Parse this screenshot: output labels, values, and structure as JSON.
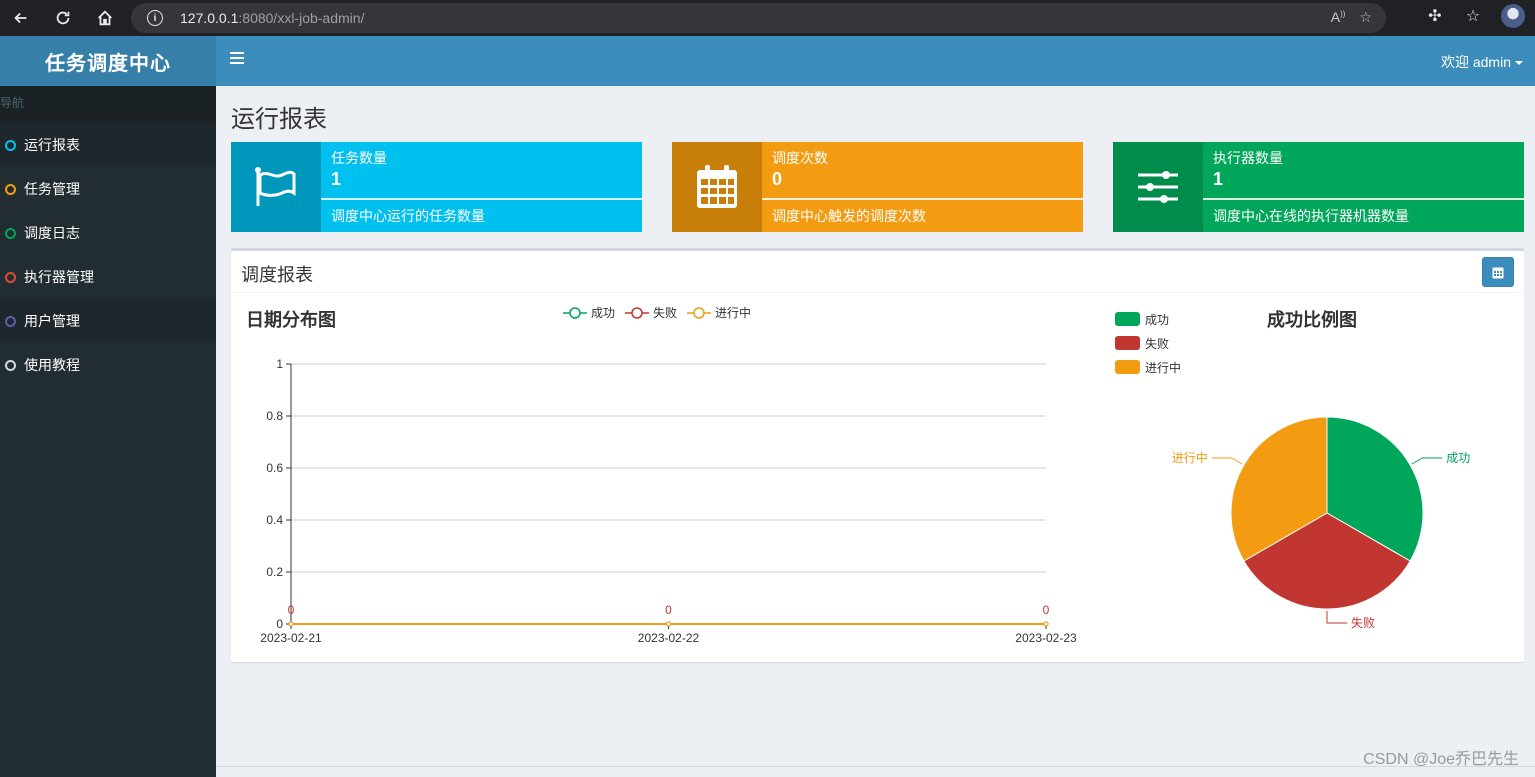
{
  "browser": {
    "url_host": "127.0.0.1",
    "url_rest": ":8080/xxl-job-admin/"
  },
  "app": {
    "logo": "任务调度中心",
    "welcome": "欢迎 admin"
  },
  "sidebar": {
    "header": "导航",
    "items": [
      {
        "label": "运行报表",
        "color": "#00c0ef",
        "state": "active"
      },
      {
        "label": "任务管理",
        "color": "#f39c12",
        "state": "normal"
      },
      {
        "label": "调度日志",
        "color": "#00a65a",
        "state": "normal"
      },
      {
        "label": "执行器管理",
        "color": "#dd4b39",
        "state": "normal"
      },
      {
        "label": "用户管理",
        "color": "#605ca8",
        "state": "hover"
      },
      {
        "label": "使用教程",
        "color": "#d2d6de",
        "state": "normal"
      }
    ]
  },
  "page": {
    "title": "运行报表"
  },
  "info_boxes": [
    {
      "label": "任务数量",
      "value": "1",
      "desc": "调度中心运行的任务数量",
      "color": "#00c0ef",
      "icon_color": "#0097bc",
      "icon": "flag-icon"
    },
    {
      "label": "调度次数",
      "value": "0",
      "desc": "调度中心触发的调度次数",
      "color": "#f39c12",
      "icon_color": "#c87f0a",
      "icon": "calendar-icon"
    },
    {
      "label": "执行器数量",
      "value": "1",
      "desc": "调度中心在线的执行器机器数量",
      "color": "#00a65a",
      "icon_color": "#008d4c",
      "icon": "sliders-icon"
    }
  ],
  "report": {
    "title": "调度报表",
    "line_title": "日期分布图",
    "pie_title": "成功比例图"
  },
  "chart_data": [
    {
      "type": "line",
      "title": "日期分布图",
      "x": [
        "2023-02-21",
        "2023-02-22",
        "2023-02-23"
      ],
      "y_ticks": [
        "0",
        "0.2",
        "0.4",
        "0.6",
        "0.8",
        "1"
      ],
      "ylim": [
        0,
        1
      ],
      "series": [
        {
          "name": "成功",
          "values": [
            0,
            0,
            0
          ],
          "color": "#00a65a"
        },
        {
          "name": "失败",
          "values": [
            0,
            0,
            0
          ],
          "color": "#c23632"
        },
        {
          "name": "进行中",
          "values": [
            0,
            0,
            0
          ],
          "color": "#f39c12"
        }
      ],
      "data_labels": [
        "0",
        "0",
        "0"
      ],
      "legend": "top-center"
    },
    {
      "type": "pie",
      "title": "成功比例图",
      "labels": [
        "成功",
        "失败",
        "进行中"
      ],
      "values": [
        1,
        1,
        1
      ],
      "colors": [
        "#00a65a",
        "#c23632",
        "#f39c12"
      ],
      "legend": "top-left"
    }
  ],
  "watermark": "CSDN @Joe乔巴先生"
}
